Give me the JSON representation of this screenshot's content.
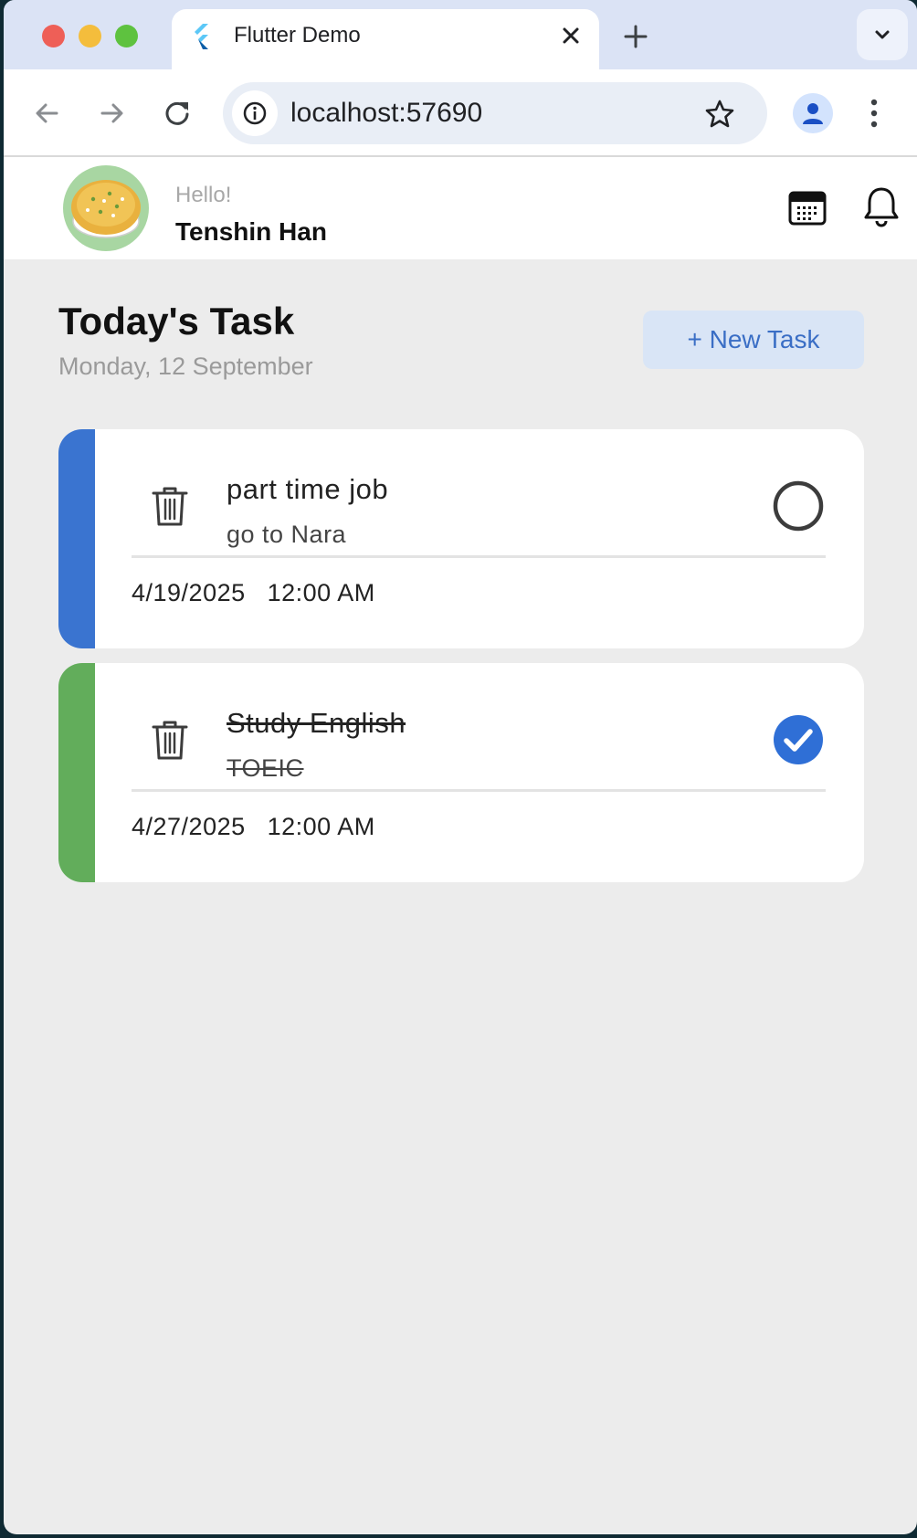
{
  "browser": {
    "tab_title": "Flutter Demo",
    "url": "localhost:57690"
  },
  "header": {
    "greeting": "Hello!",
    "username": "Tenshin Han"
  },
  "main": {
    "title": "Today's Task",
    "date": "Monday, 12 September",
    "new_task_label": "+ New Task"
  },
  "tasks": [
    {
      "title": "part time job",
      "subtitle": "go to Nara",
      "date": "4/19/2025",
      "time": "12:00 AM",
      "completed": false,
      "color": "#3a74d0"
    },
    {
      "title": "Study English",
      "subtitle": "TOEIC",
      "date": "4/27/2025",
      "time": "12:00 AM",
      "completed": true,
      "color": "#62ad5b"
    }
  ],
  "colors": {
    "accent": "#3a6ec5",
    "check_blue": "#2f6fd6"
  }
}
